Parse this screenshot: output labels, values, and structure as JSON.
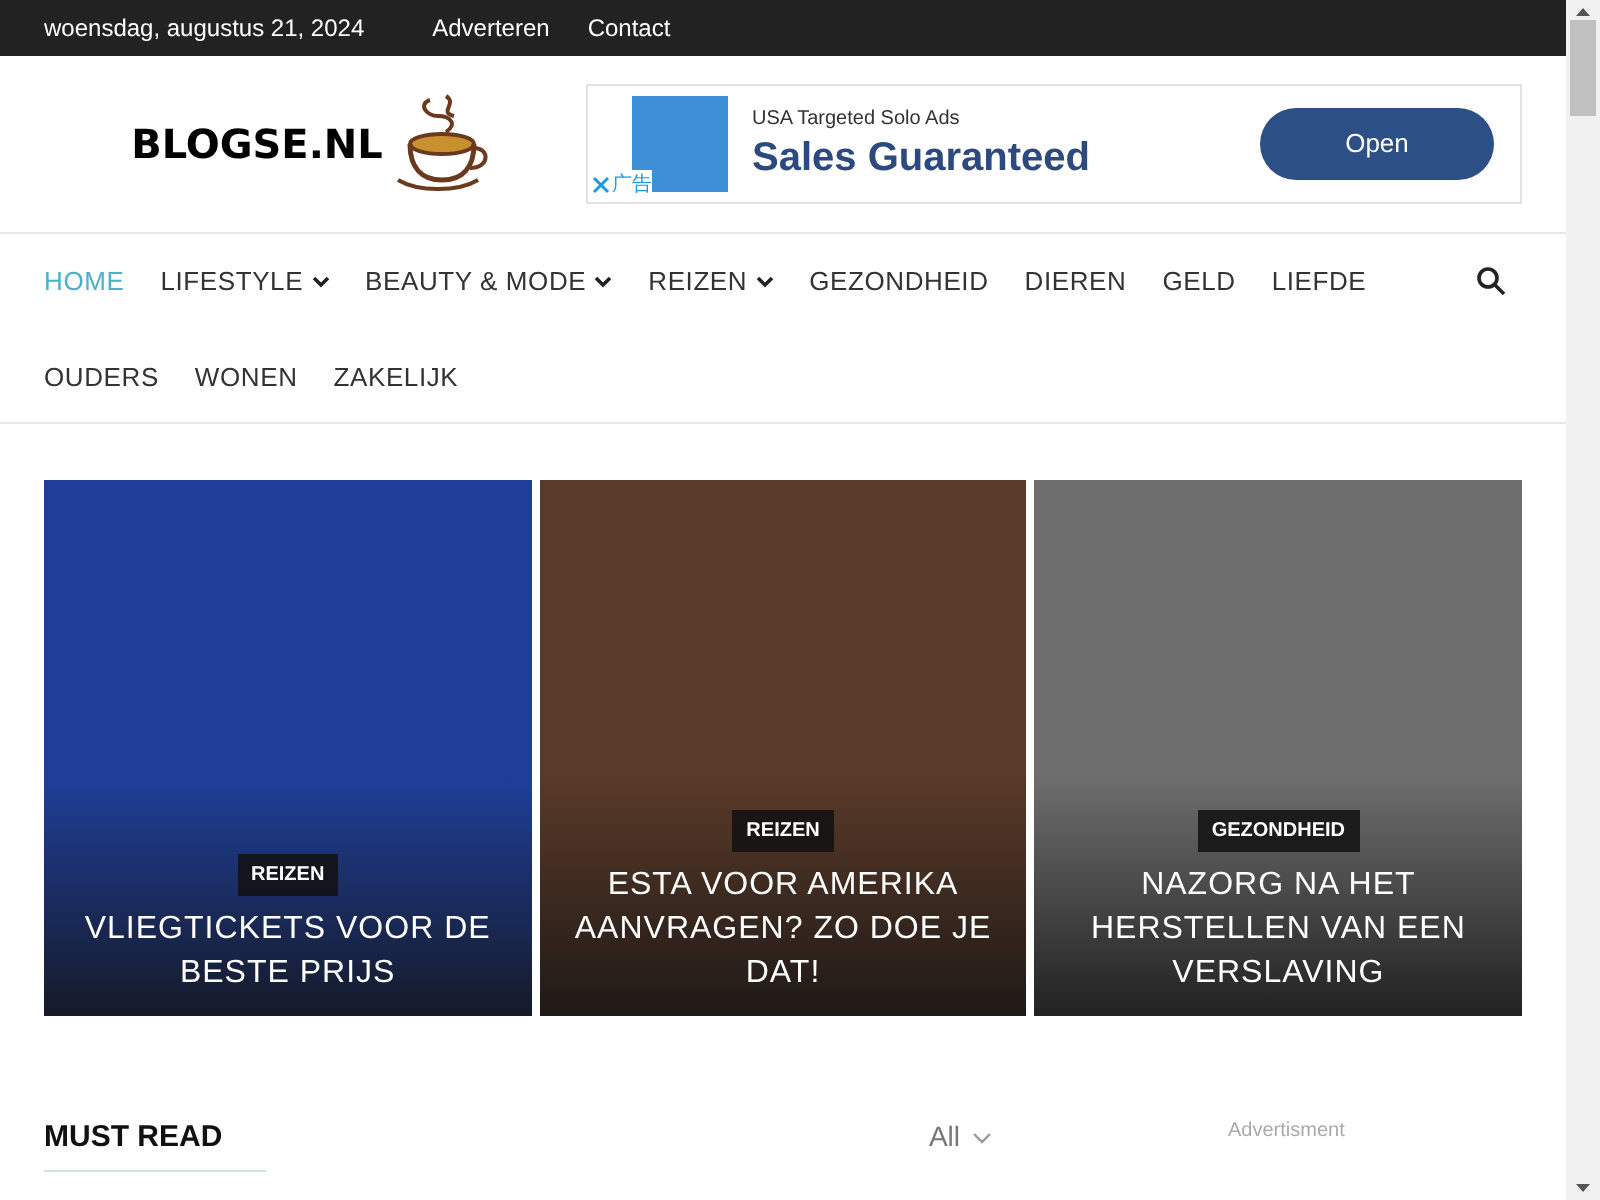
{
  "top_bar": {
    "date": "woensdag, augustus 21, 2024",
    "links": [
      "Adverteren",
      "Contact"
    ]
  },
  "header": {
    "logo": "BLOGSE.NL",
    "ad": {
      "small_text": "USA Targeted Solo Ads",
      "headline": "Sales Guaranteed",
      "button": "Open",
      "ad_label": "广告"
    }
  },
  "nav": {
    "items": [
      {
        "label": "HOME",
        "selected": true,
        "dropdown": false
      },
      {
        "label": "LIFESTYLE",
        "selected": false,
        "dropdown": true
      },
      {
        "label": "BEAUTY & MODE",
        "selected": false,
        "dropdown": true
      },
      {
        "label": "REIZEN",
        "selected": false,
        "dropdown": true
      },
      {
        "label": "GEZONDHEID",
        "selected": false,
        "dropdown": false
      },
      {
        "label": "DIEREN",
        "selected": false,
        "dropdown": false
      },
      {
        "label": "GELD",
        "selected": false,
        "dropdown": false
      },
      {
        "label": "LIEFDE",
        "selected": false,
        "dropdown": false
      },
      {
        "label": "OUDERS",
        "selected": false,
        "dropdown": false
      },
      {
        "label": "WONEN",
        "selected": false,
        "dropdown": false
      },
      {
        "label": "ZAKELIJK",
        "selected": false,
        "dropdown": false
      }
    ]
  },
  "featured": [
    {
      "category": "REIZEN",
      "title": "VLIEGTICKETS VOOR DE BESTE PRIJS",
      "color": "#1f3f9a"
    },
    {
      "category": "REIZEN",
      "title": "ESTA VOOR AMERIKA AANVRAGEN? ZO DOE JE DAT!",
      "color": "#5a3a28"
    },
    {
      "category": "GEZONDHEID",
      "title": "NAZORG NA HET HERSTELLEN VAN EEN VERSLAVING",
      "color": "#6e6e6e"
    }
  ],
  "must_read": {
    "title": "MUST READ",
    "filter": "All"
  },
  "sidebar": {
    "label": "Advertisment"
  }
}
